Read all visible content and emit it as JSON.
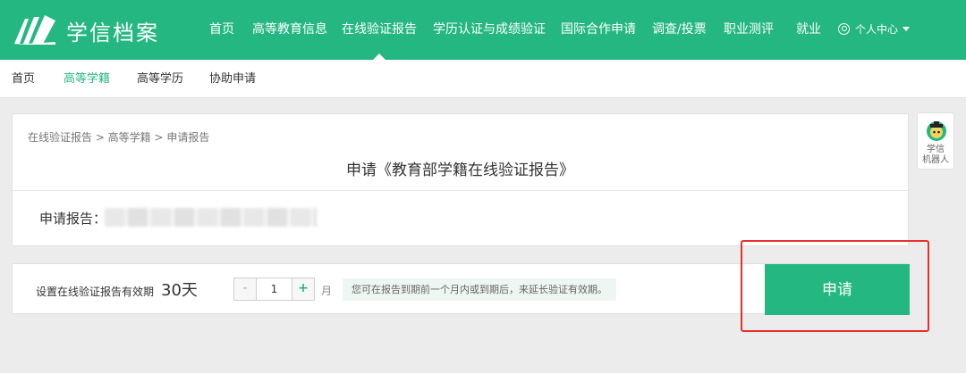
{
  "brand": {
    "name": "学信档案"
  },
  "topnav": {
    "items": [
      {
        "label": "首页"
      },
      {
        "label": "高等教育信息"
      },
      {
        "label": "在线验证报告"
      },
      {
        "label": "学历认证与成绩验证"
      },
      {
        "label": "国际合作申请"
      },
      {
        "label": "调查/投票"
      },
      {
        "label": "职业测评"
      },
      {
        "label": "就业"
      }
    ],
    "user_menu": "个人中心"
  },
  "subnav": {
    "items": [
      {
        "label": "首页"
      },
      {
        "label": "高等学籍"
      },
      {
        "label": "高等学历"
      },
      {
        "label": "协助申请"
      }
    ]
  },
  "main": {
    "breadcrumb": "在线验证报告 > 高等学籍 > 申请报告",
    "title": "申请《教育部学籍在线验证报告》",
    "report_label": "申请报告："
  },
  "validity": {
    "label": "设置在线验证报告有效期",
    "days": "30天",
    "minus": "-",
    "plus": "+",
    "value": "1",
    "unit": "月",
    "hint": "您可在报告到期前一个月内或到期后，来延长验证有效期。"
  },
  "apply_button": "申请",
  "robot": {
    "label_line1": "学信",
    "label_line2": "机器人"
  },
  "colors": {
    "brand_green": "#25b782",
    "highlight_red": "#e8302b"
  }
}
